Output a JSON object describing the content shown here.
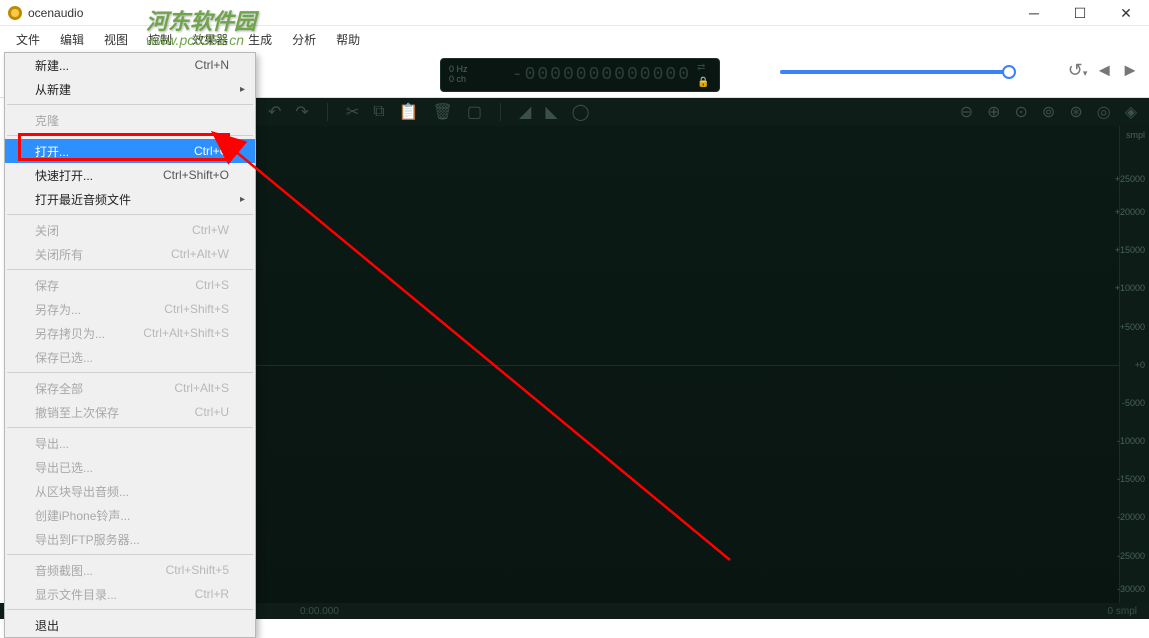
{
  "app": {
    "title": "ocenaudio"
  },
  "watermark": {
    "line1": "河东软件园",
    "line2": "www.pc0359.cn"
  },
  "menubar": [
    "文件",
    "编辑",
    "视图",
    "控制",
    "效果器",
    "生成",
    "分析",
    "帮助"
  ],
  "display": {
    "hz": "0 Hz",
    "ch": "0 ch",
    "digits": "-0000000000000"
  },
  "ruler": {
    "unit": "smpl",
    "ticks": [
      "+25000",
      "+20000",
      "+15000",
      "+10000",
      "+5000",
      "+0",
      "-5000",
      "-10000",
      "-15000",
      "-20000",
      "-25000",
      "-30000"
    ]
  },
  "timer": "0:00.000",
  "sample": "0 smpl",
  "menu": {
    "items": [
      {
        "label": "新建...",
        "shortcut": "Ctrl+N",
        "enabled": true
      },
      {
        "label": "从新建",
        "submenu": true,
        "enabled": true
      },
      {
        "sep": true
      },
      {
        "label": "克隆",
        "enabled": false
      },
      {
        "sep": true
      },
      {
        "label": "打开...",
        "shortcut": "Ctrl+O",
        "enabled": true,
        "hover": true
      },
      {
        "label": "快速打开...",
        "shortcut": "Ctrl+Shift+O",
        "enabled": true
      },
      {
        "label": "打开最近音频文件",
        "submenu": true,
        "enabled": true
      },
      {
        "sep": true
      },
      {
        "label": "关闭",
        "shortcut": "Ctrl+W",
        "enabled": false
      },
      {
        "label": "关闭所有",
        "shortcut": "Ctrl+Alt+W",
        "enabled": false
      },
      {
        "sep": true
      },
      {
        "label": "保存",
        "shortcut": "Ctrl+S",
        "enabled": false
      },
      {
        "label": "另存为...",
        "shortcut": "Ctrl+Shift+S",
        "enabled": false
      },
      {
        "label": "另存拷贝为...",
        "shortcut": "Ctrl+Alt+Shift+S",
        "enabled": false
      },
      {
        "label": "保存已选...",
        "enabled": false
      },
      {
        "sep": true
      },
      {
        "label": "保存全部",
        "shortcut": "Ctrl+Alt+S",
        "enabled": false
      },
      {
        "label": "撤销至上次保存",
        "shortcut": "Ctrl+U",
        "enabled": false
      },
      {
        "sep": true
      },
      {
        "label": "导出...",
        "enabled": false
      },
      {
        "label": "导出已选...",
        "enabled": false
      },
      {
        "label": "从区块导出音频...",
        "enabled": false
      },
      {
        "label": "创建iPhone铃声...",
        "enabled": false
      },
      {
        "label": "导出到FTP服务器...",
        "enabled": false
      },
      {
        "sep": true
      },
      {
        "label": "音频截图...",
        "shortcut": "Ctrl+Shift+5",
        "enabled": false
      },
      {
        "label": "显示文件目录...",
        "shortcut": "Ctrl+R",
        "enabled": false
      },
      {
        "sep": true
      },
      {
        "label": "退出",
        "enabled": true
      }
    ]
  }
}
